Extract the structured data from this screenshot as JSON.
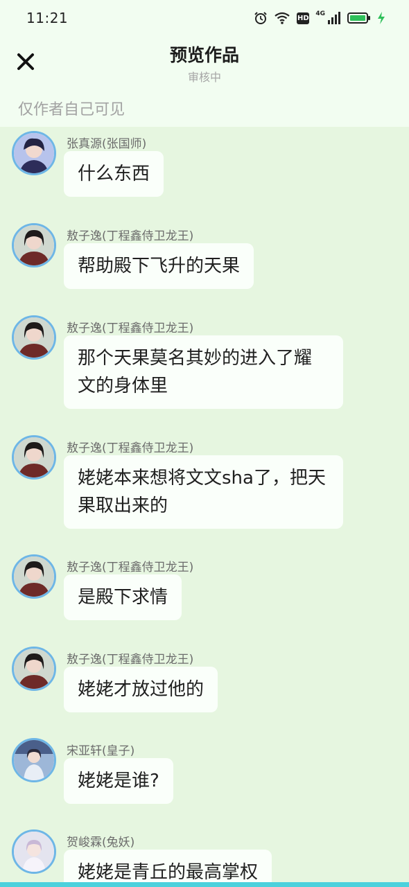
{
  "status_bar": {
    "time": "11:21",
    "icons": [
      "alarm-icon",
      "wifi-icon",
      "hd-icon",
      "signal-icon",
      "battery-icon",
      "charging-icon"
    ],
    "hd_label": "HD",
    "network": "4G"
  },
  "header": {
    "close_icon": "close-icon",
    "title": "预览作品",
    "subtitle": "审核中",
    "visibility_note": "仅作者自己可见"
  },
  "colors": {
    "chat_background": "#e6f6e0",
    "header_background": "#f2fdf1",
    "bubble": "#fafffa",
    "avatar_ring": "#6eb6e6",
    "bottom_accent": "#4bd1dc"
  },
  "messages": [
    {
      "sender": "张真源(张国师)",
      "text": "什么东西",
      "avatar": "avatar-zhang"
    },
    {
      "sender": "敖子逸(丁程鑫侍卫龙王)",
      "text": "帮助殿下飞升的天果",
      "avatar": "avatar-ao"
    },
    {
      "sender": "敖子逸(丁程鑫侍卫龙王)",
      "text": "那个天果莫名其妙的进入了耀文的身体里",
      "avatar": "avatar-ao"
    },
    {
      "sender": "敖子逸(丁程鑫侍卫龙王)",
      "text": "姥姥本来想将文文sha了，把天果取出来的",
      "avatar": "avatar-ao"
    },
    {
      "sender": "敖子逸(丁程鑫侍卫龙王)",
      "text": "是殿下求情",
      "avatar": "avatar-ao"
    },
    {
      "sender": "敖子逸(丁程鑫侍卫龙王)",
      "text": "姥姥才放过他的",
      "avatar": "avatar-ao"
    },
    {
      "sender": "宋亚轩(皇子)",
      "text": "姥姥是谁?",
      "avatar": "avatar-song"
    },
    {
      "sender": "贺峻霖(兔妖)",
      "text": "姥姥是青丘的最高掌权",
      "avatar": "avatar-he"
    }
  ]
}
